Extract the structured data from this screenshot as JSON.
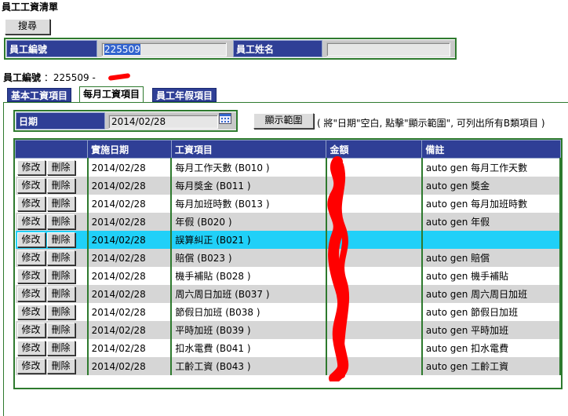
{
  "page": {
    "title": "員工工資清單"
  },
  "toolbar": {
    "search_label": "搜尋"
  },
  "filter": {
    "emp_id_label": "員工編號",
    "emp_id_value": "225509",
    "emp_name_label": "員工姓名",
    "emp_name_value": ""
  },
  "info": {
    "label": "員工編號",
    "value": "：225509 -"
  },
  "tabs": [
    {
      "label": "基本工資項目",
      "active": false
    },
    {
      "label": "每月工資項目",
      "active": true
    },
    {
      "label": "員工年假項目",
      "active": false
    }
  ],
  "date_filter": {
    "label": "日期",
    "value": "2014/02/28",
    "range_button": "顯示範圍",
    "note": "( 將\"日期\"空白, 點擊\"顯示範圍\", 可列出所有B類項目 )"
  },
  "table": {
    "headers": [
      "",
      "實施日期",
      "工資項目",
      "金額",
      "備註"
    ],
    "edit_label": "修改",
    "delete_label": "刪除",
    "rows": [
      {
        "date": "2014/02/28",
        "item": "每月工作天數 (B010 )",
        "amount": "",
        "note": "auto gen 每月工作天數"
      },
      {
        "date": "2014/02/28",
        "item": "每月獎金 (B011 )",
        "amount": "",
        "note": "auto gen 獎金"
      },
      {
        "date": "2014/02/28",
        "item": "每月加班時數 (B013 )",
        "amount": "",
        "note": "auto gen 每月加班時數"
      },
      {
        "date": "2014/02/28",
        "item": "年假 (B020 )",
        "amount": "",
        "note": "auto gen 年假"
      },
      {
        "date": "2014/02/28",
        "item": "誤算糾正 (B021 )",
        "amount": "",
        "note": "",
        "selected": true
      },
      {
        "date": "2014/02/28",
        "item": "賠償 (B023 )",
        "amount": "",
        "note": "auto gen 賠償"
      },
      {
        "date": "2014/02/28",
        "item": "機手補貼 (B028 )",
        "amount": "",
        "note": "auto gen 機手補貼"
      },
      {
        "date": "2014/02/28",
        "item": "周六周日加班 (B037 )",
        "amount": "",
        "note": "auto gen 周六周日加班"
      },
      {
        "date": "2014/02/28",
        "item": "節假日加班 (B038 )",
        "amount": "",
        "note": "auto gen 節假日加班"
      },
      {
        "date": "2014/02/28",
        "item": "平時加班 (B039 )",
        "amount": "",
        "note": "auto gen 平時加班"
      },
      {
        "date": "2014/02/28",
        "item": "扣水電費 (B041 )",
        "amount": "",
        "note": "auto gen 扣水電費"
      },
      {
        "date": "2014/02/28",
        "item": "工齡工資 (B043 )",
        "amount": "",
        "note": "auto gen 工齡工資"
      }
    ]
  },
  "colors": {
    "header_blue": "#2f3f96",
    "border_green": "#2e7a2e",
    "selected_row": "#20d0f8",
    "redaction": "#ff0000"
  }
}
